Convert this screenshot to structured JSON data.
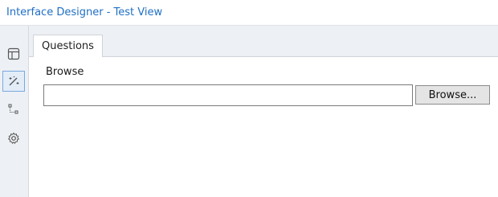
{
  "window": {
    "title": "Interface Designer - Test View"
  },
  "sidebar": {
    "items": [
      {
        "icon": "layout-icon",
        "active": false
      },
      {
        "icon": "magic-wand-icon",
        "active": true
      },
      {
        "icon": "tree-icon",
        "active": false
      },
      {
        "icon": "gear-icon",
        "active": false
      }
    ]
  },
  "tabs": [
    {
      "label": "Questions",
      "active": true
    }
  ],
  "form": {
    "browse_label": "Browse",
    "file_path_value": "",
    "browse_button_label": "Browse..."
  },
  "colors": {
    "title_text": "#1f6fc5",
    "rail_background": "#edf0f4",
    "active_rail_border": "#7aa9dd"
  }
}
